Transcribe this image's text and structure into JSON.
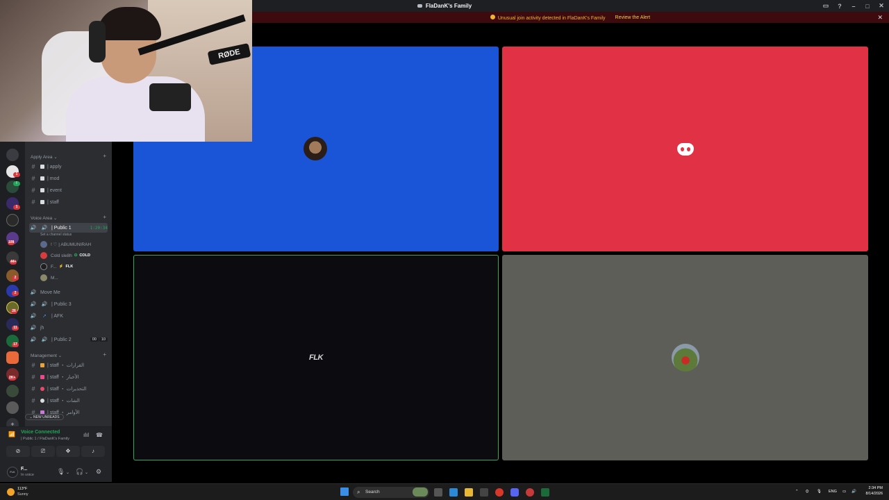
{
  "window": {
    "title": "FlaDanK's Family",
    "controls": [
      "inbox-icon",
      "help-icon",
      "minimize-icon",
      "maximize-icon",
      "close-icon"
    ]
  },
  "alert": {
    "text": "Unusual join activity detected in FlaDanK's Family",
    "action": "Review the Alert",
    "close": "✕"
  },
  "server_rail": {
    "badges": [
      "1",
      "!",
      "1",
      "1",
      "109",
      "44+",
      "2",
      "2",
      "26",
      "11",
      "17",
      "2K+"
    ]
  },
  "sidebar": {
    "categories": {
      "apply": "Apply Area",
      "voice": "Voice Area",
      "management": "Management"
    },
    "apply_channels": [
      "| apply",
      "| mod",
      "| event",
      "| staff"
    ],
    "voice_active": {
      "name": "| Public 1",
      "timer": "1:20:34",
      "status": "Set a channel status",
      "users": [
        {
          "name": "! ♡ | ABUMUNIRAH",
          "tag": ""
        },
        {
          "name": "Cold sle8h",
          "tag": "COLD"
        },
        {
          "name": "F...",
          "tag": "FLK"
        },
        {
          "name": "M...",
          "tag": ""
        }
      ]
    },
    "voice_channels": [
      {
        "name": "Move Me"
      },
      {
        "name": "| Public 3"
      },
      {
        "name": "| AFK"
      },
      {
        "name": "jh"
      },
      {
        "name": "| Public 2",
        "counts": [
          "00",
          "10"
        ]
      }
    ],
    "management_channels": [
      "| staff ・ القرارات",
      "| staff ・ الأخبار",
      "| staff ・ التحذيرات",
      "| staff ・ الشات",
      "| staff ・ الأوامر"
    ],
    "new_unreads": "NEW UNREADS"
  },
  "voice_panel": {
    "title": "Voice Connected",
    "subtitle": "| Public 1 / FlaDanK's Family"
  },
  "user_panel": {
    "avatar_text": "FLK",
    "name": "F...",
    "status": "In voice"
  },
  "tiles": [
    {
      "color": "#1a55d7",
      "content": "avatar"
    },
    {
      "color": "#e03145",
      "content": "discord-logo"
    },
    {
      "color": "#0c0b10",
      "content": "FLK",
      "speaking": true
    },
    {
      "color": "#5d5e58",
      "content": "avatar"
    }
  ],
  "taskbar": {
    "weather_temp": "113°F",
    "weather_cond": "Sunny",
    "search": "Search",
    "lang": "ENG",
    "time": "2:34 PM",
    "date": "8/14/2026"
  },
  "colors": {
    "accent_green": "#23a559",
    "alert_bg": "#3d0b0d",
    "tile_blue": "#1a55d7",
    "tile_red": "#e03145"
  }
}
